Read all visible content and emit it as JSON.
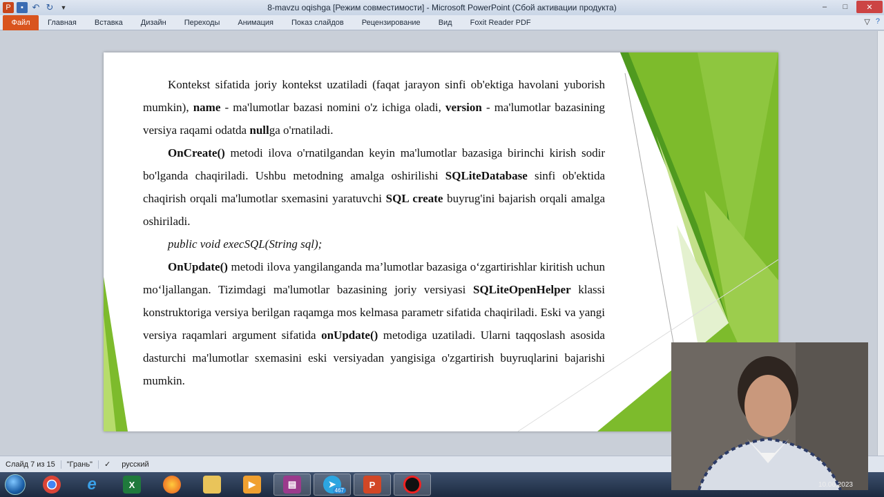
{
  "window": {
    "title": "8-mavzu oqishga [Режим совместимости]  -  Microsoft PowerPoint (Сбой активации продукта)",
    "controls": {
      "minimize": "–",
      "maximize": "□",
      "close": "✕"
    }
  },
  "quick_access": {
    "app_icon": "P",
    "items": [
      "save-icon",
      "undo-icon",
      "redo-icon",
      "customize-icon"
    ]
  },
  "ribbon": {
    "file_tab": "Файл",
    "tabs": [
      "Главная",
      "Вставка",
      "Дизайн",
      "Переходы",
      "Анимация",
      "Показ слайдов",
      "Рецензирование",
      "Вид",
      "Foxit Reader PDF"
    ]
  },
  "slide": {
    "p1": {
      "a": "Kontekst sifatida joriy kontekst uzatiladi (faqat jarayon sinfi ob'ektiga havolani yuborish mumkin), ",
      "b1": "name",
      "c": " - ma'lumotlar bazasi nomini o'z ichiga oladi, ",
      "b2": "version",
      "d": " - ma'lumotlar bazasining versiya raqami odatda ",
      "b3": "null",
      "e": "ga o'rnatiladi."
    },
    "p2": {
      "b1": "OnCreate()",
      "a": " metodi ilova o'rnatilgandan keyin ma'lumotlar bazasiga birinchi kirish sodir bo'lganda chaqiriladi. Ushbu metodning amalga oshirilishi ",
      "b2": "SQLiteDatabase",
      "c": " sinfi ob'ektida chaqirish orqali ma'lumotlar sxemasini yaratuvchi ",
      "b3": "SQL create",
      "d": " buyrug'ini bajarish orqali amalga oshiriladi."
    },
    "code": "public void execSQL(String sql);",
    "p3": {
      "b1": "OnUpdate()",
      "a": " metodi ilova yangilanganda ma’lumotlar bazasiga o‘zgartirishlar kiritish uchun mo‘ljallangan. Tizimdagi ma'lumotlar bazasining joriy versiyasi ",
      "b2": "SQLiteOpenHelper",
      "c": " klassi konstruktoriga versiya berilgan raqamga mos kelmasa parametr sifatida chaqiriladi. Eski va yangi versiya raqamlari argument sifatida ",
      "b3": "onUpdate()",
      "d": " metodiga uzatiladi. Ularni taqqoslash asosida dasturchi ma'lumotlar sxemasini eski versiyadan yangisiga o'zgartirish buyruqlarini bajarishi mumkin."
    }
  },
  "status_bar": {
    "slide_info": "Слайд 7 из 15",
    "theme": "\"Грань\"",
    "language": "русский"
  },
  "taskbar": {
    "items": [
      "chrome-icon",
      "ie-icon",
      "excel-icon",
      "firefox-icon",
      "explorer-icon",
      "media-player-icon",
      "archive-icon",
      "telegram-icon",
      "powerpoint-icon",
      "recorder-icon"
    ],
    "telegram_badge": "467",
    "date": "10.06.2023"
  },
  "colors": {
    "accent_green": "#7dbb2c",
    "dark_green": "#4f9a1f",
    "light_green": "#b7dc6c",
    "file_tab": "#d9541e"
  }
}
